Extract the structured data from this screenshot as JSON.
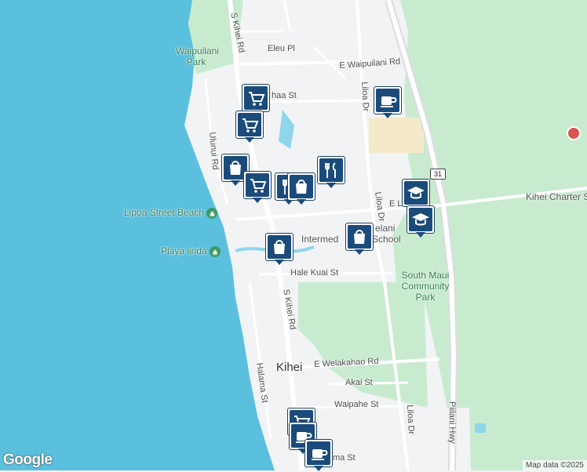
{
  "map": {
    "colors": {
      "water": "#5bc0de",
      "land": "#f1f3f4",
      "park": "#c8ebd0",
      "road": "#ffffff",
      "highway": "#dadce0",
      "marker": "#1a4b7a"
    },
    "road_labels": {
      "s_kihei_rd_north": "S Kihei Rd",
      "eleu_pl": "Eleu Pl",
      "e_waipuilani_rd": "E Waipuilani Rd",
      "kaiohaa_st": "haa St",
      "liloa_dr_north": "Liloa Dr",
      "ulunui_rd": "Ulunui Rd",
      "liloa_dr_mid": "Liloa Dr",
      "e_lipoa": "E Li",
      "hale_kuai_st": "Hale Kuai St",
      "s_kihei_rd_south": "S Kihei Rd",
      "halama_st": "Halama St",
      "e_welakahao_rd": "E Welakahao Rd",
      "akai_st": "Akai St",
      "waipahe_st": "Waipahe St",
      "liloa_dr_south": "Liloa Dr",
      "piilani_hwy": "Piilani Hwy",
      "halama_st_south": "ma St",
      "route_31": "31"
    },
    "place_labels": {
      "waipuilani_park": "Waipuilani Park",
      "lipoa_street_beach": "Lipoa Street Beach",
      "playa_linda": "Playa linda",
      "lokelani_school": "Intermed",
      "lokelani_school_top": "elani",
      "lokelani_school_rest": "School",
      "kihei_charter": "Kihei Charter Sch",
      "south_maui_park": "South Maui Community Park",
      "kihei": "Kihei"
    },
    "google_logo": "Google",
    "attribution": "Map data ©2025",
    "markers": [
      {
        "icon": "cart-icon"
      },
      {
        "icon": "cart-icon"
      },
      {
        "icon": "cup-icon"
      },
      {
        "icon": "shopping-bag-icon"
      },
      {
        "icon": "restaurant-icon"
      },
      {
        "icon": "cart-icon"
      },
      {
        "icon": "restaurant-icon"
      },
      {
        "icon": "shopping-bag-icon"
      },
      {
        "icon": "school-icon"
      },
      {
        "icon": "school-icon"
      },
      {
        "icon": "shopping-bag-icon"
      },
      {
        "icon": "shopping-bag-icon"
      },
      {
        "icon": "cart-icon"
      },
      {
        "icon": "cup-icon"
      },
      {
        "icon": "cup-icon"
      }
    ]
  }
}
